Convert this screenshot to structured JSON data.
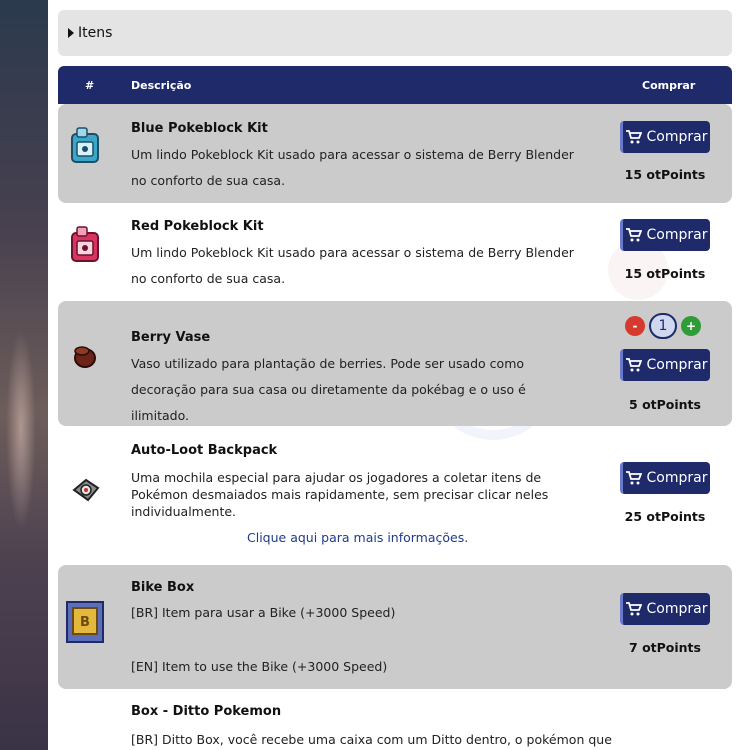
{
  "itens_section": {
    "label": "Itens"
  },
  "table_header": {
    "col_number": "#",
    "col_description": "Descrição",
    "col_buy": "Comprar"
  },
  "buy_label": "Comprar",
  "items": [
    {
      "title": "Blue Pokeblock Kit",
      "description": "Um lindo Pokeblock Kit usado para acessar o sistema de Berry Blender no conforto de sua casa.",
      "price": "15 otPoints",
      "icon": "blue-pokeblock-kit-icon"
    },
    {
      "title": "Red Pokeblock Kit",
      "description": "Um lindo Pokeblock Kit usado para acessar o sistema de Berry Blender no conforto de sua casa.",
      "price": "15 otPoints",
      "icon": "red-pokeblock-kit-icon"
    },
    {
      "title": "Berry Vase",
      "description": "Vaso utilizado para plantação de berries. Pode ser usado como decoração para sua casa ou diretamente da pokébag e o uso é ilimitado.",
      "price": "5 otPoints",
      "icon": "berry-vase-icon",
      "quantity": {
        "minus": "-",
        "value": "1",
        "plus": "+"
      }
    },
    {
      "title": "Auto-Loot Backpack",
      "description": "Uma mochila especial para ajudar os jogadores a coletar itens de Pokémon desmaiados mais rapidamente, sem precisar clicar neles individualmente.",
      "more_info": "Clique aqui para mais informações.",
      "price": "25 otPoints",
      "icon": "backpack-icon"
    },
    {
      "title": "Bike Box",
      "description_br": "[BR] Item para usar a Bike (+3000 Speed)",
      "description_en": "[EN] Item to use the Bike (+3000 Speed)",
      "price": "7 otPoints",
      "icon": "bike-box-icon"
    },
    {
      "title": "Box - Ditto Pokemon",
      "description_br": "[BR] Ditto Box, você recebe uma caixa com um Ditto dentro, o pokémon que"
    }
  ],
  "colors": {
    "header_bg": "#1f2a6b",
    "row_grey": "#cbcbcb",
    "minus_red": "#d63a2f",
    "plus_green": "#2e9c39",
    "link_blue": "#1f3a8a"
  }
}
